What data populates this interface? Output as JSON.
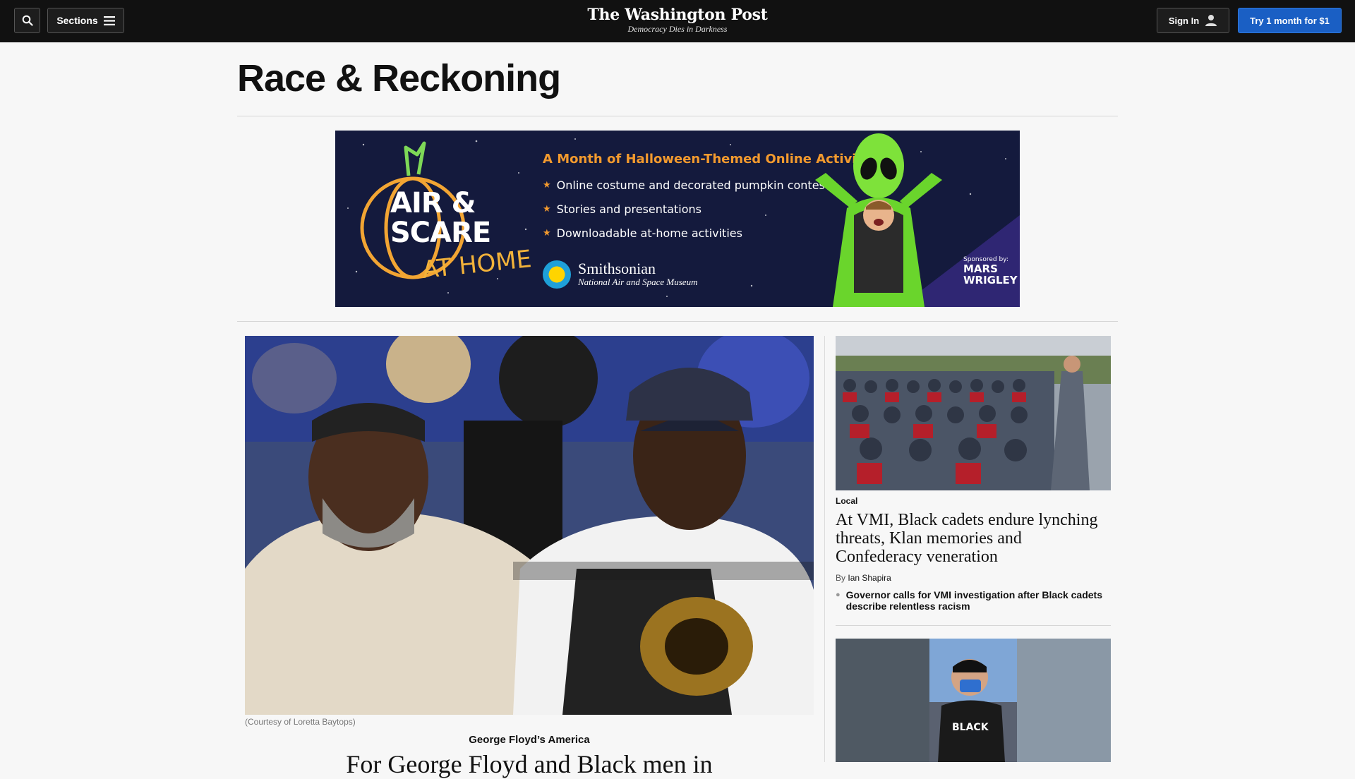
{
  "header": {
    "sections_label": "Sections",
    "logo_text": "The Washington Post",
    "tagline": "Democracy Dies in Darkness",
    "signin_label": "Sign In",
    "subscribe_label": "Try 1 month for $1",
    "subscribe_color": "#1a5fc4"
  },
  "page": {
    "title": "Race & Reckoning"
  },
  "ad": {
    "pumpkin_line1": "AIR &",
    "pumpkin_line2": "SCARE",
    "at_home": "AT HOME",
    "headline": "A Month of Halloween-Themed Online Activities",
    "bullets": [
      "Online costume and decorated pumpkin contests",
      "Stories and presentations",
      "Downloadable at-home activities"
    ],
    "org_name": "Smithsonian",
    "org_sub": "National Air and Space Museum",
    "sponsored_by": "Sponsored by:",
    "sponsor_line1": "MARS",
    "sponsor_line2": "WRIGLEY"
  },
  "lead_story": {
    "caption": "(Courtesy of Loretta Baytops)",
    "kicker": "George Floyd’s America",
    "headline": "For George Floyd and Black men in"
  },
  "side_story": {
    "kicker": "Local",
    "headline": "At VMI, Black cadets endure lynching threats, Klan memories and Confederacy veneration",
    "byline_prefix": "By",
    "author": "Ian Shapira",
    "related": "Governor calls for VMI investigation after Black cadets describe relentless racism"
  },
  "icons": {
    "search": "search-icon",
    "menu": "hamburger-icon",
    "user": "user-icon",
    "star": "star-icon",
    "sun": "smithsonian-sun-icon"
  }
}
